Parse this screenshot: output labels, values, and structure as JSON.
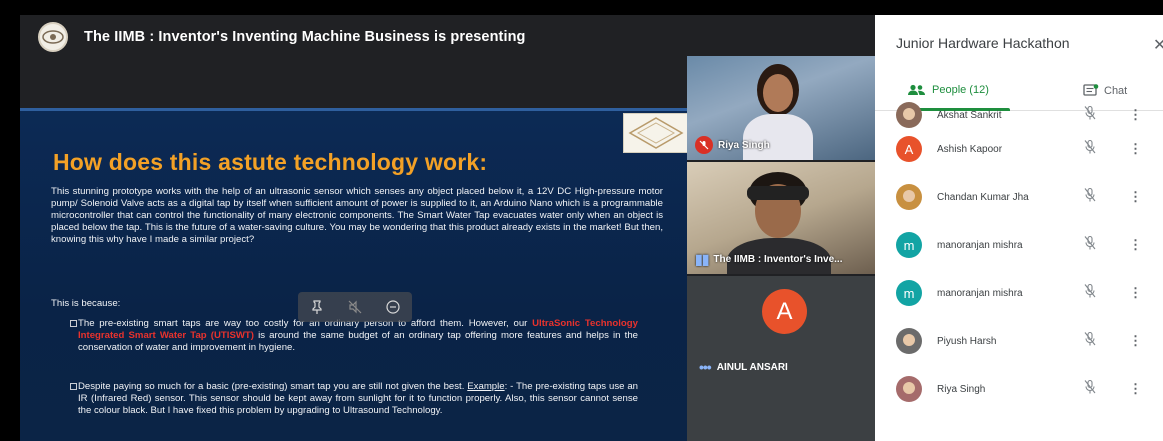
{
  "presenter": {
    "title": "The IIMB : Inventor's Inventing Machine Business is presenting"
  },
  "slide": {
    "logo_text": "IIMB",
    "title": "How does this astute technology work:",
    "paragraph": "This stunning prototype works with the help of an ultrasonic sensor which senses any object placed below it, a 12V DC High-pressure motor pump/ Solenoid Valve acts as a digital tap by itself when sufficient amount of power is supplied to it, an Arduino Nano which is a programmable microcontroller that can control the functionality of many electronic components. The Smart Water Tap evacuates water only when an object is placed below the tap. This is the future of a water-saving culture. You may be wondering that this product already exists in the market! But then, knowing this why have I made a similar project?",
    "because": "This is because:",
    "bullet1_a": "The pre-existing smart taps are way too costly for an ordinary person to afford them. However, our ",
    "bullet1_red": "UltraSonic Technology Integrated Smart Water Tap (UTISWT)",
    "bullet1_b": " is around the same budget of an ordinary tap offering more features and helps in the conservation of water and improvement in hygiene.",
    "bullet2_a": "Despite paying so much for a basic (pre-existing) smart tap you are still not given the best. ",
    "bullet2_example": "Example",
    "bullet2_b": ": - The pre-existing taps use an IR (Infrared Red) sensor. This sensor should be kept away from sunlight for it to function properly. Also, this sensor cannot sense the colour black. But I have fixed this problem by upgrading to Ultrasound Technology."
  },
  "tiles": [
    {
      "label": "Riya Singh"
    },
    {
      "label": "The IIMB : Inventor's Inve..."
    },
    {
      "label": "AINUL ANSARI",
      "initial": "A"
    }
  ],
  "panel": {
    "title": "Junior Hardware Hackathon",
    "close_glyph": "✕",
    "tab_people": "People (12)",
    "tab_chat": "Chat",
    "participants": [
      {
        "name": "Akshat Sankrit",
        "avatar": "photo",
        "color": "#8a6a5a"
      },
      {
        "name": "Ashish Kapoor",
        "avatar": "A",
        "color": "#e8522b"
      },
      {
        "name": "Chandan Kumar Jha",
        "avatar": "photo",
        "color": "#c89040"
      },
      {
        "name": "manoranjan mishra",
        "avatar": "m",
        "color": "#12a4a4"
      },
      {
        "name": "manoranjan mishra",
        "avatar": "m",
        "color": "#12a4a4"
      },
      {
        "name": "Piyush Harsh",
        "avatar": "photo",
        "color": "#6b6b6b"
      },
      {
        "name": "Riya Singh",
        "avatar": "photo",
        "color": "#a56b6b"
      }
    ]
  }
}
